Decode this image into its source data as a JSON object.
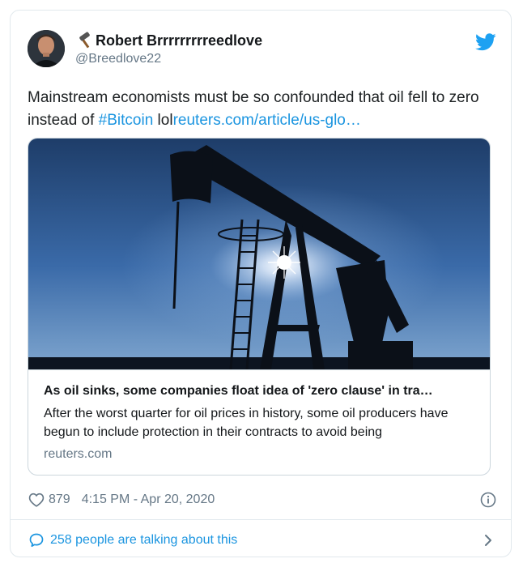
{
  "author": {
    "emoji_icon": "hammer-icon",
    "name": "Robert Brrrrrrrrreedlove",
    "handle": "@Breedlove22"
  },
  "tweet": {
    "text_before": "Mainstream economists must be so confounded that oil fell to zero instead of ",
    "hashtag": "#Bitcoin",
    "text_mid": " lol",
    "link_text": "reuters.com/article/us-glo…"
  },
  "card": {
    "title": "As oil sinks, some companies float idea of 'zero clause' in tra…",
    "description": "After the worst quarter for oil prices in history, some oil producers have begun to include protection in their contracts to avoid being",
    "domain": "reuters.com"
  },
  "meta": {
    "likes": "879",
    "timestamp": "4:15 PM - Apr 20, 2020"
  },
  "footer": {
    "talking": "258 people are talking about this"
  },
  "colors": {
    "link": "#1b95e0",
    "secondary_text": "#657786",
    "border": "#e1e8ed"
  }
}
